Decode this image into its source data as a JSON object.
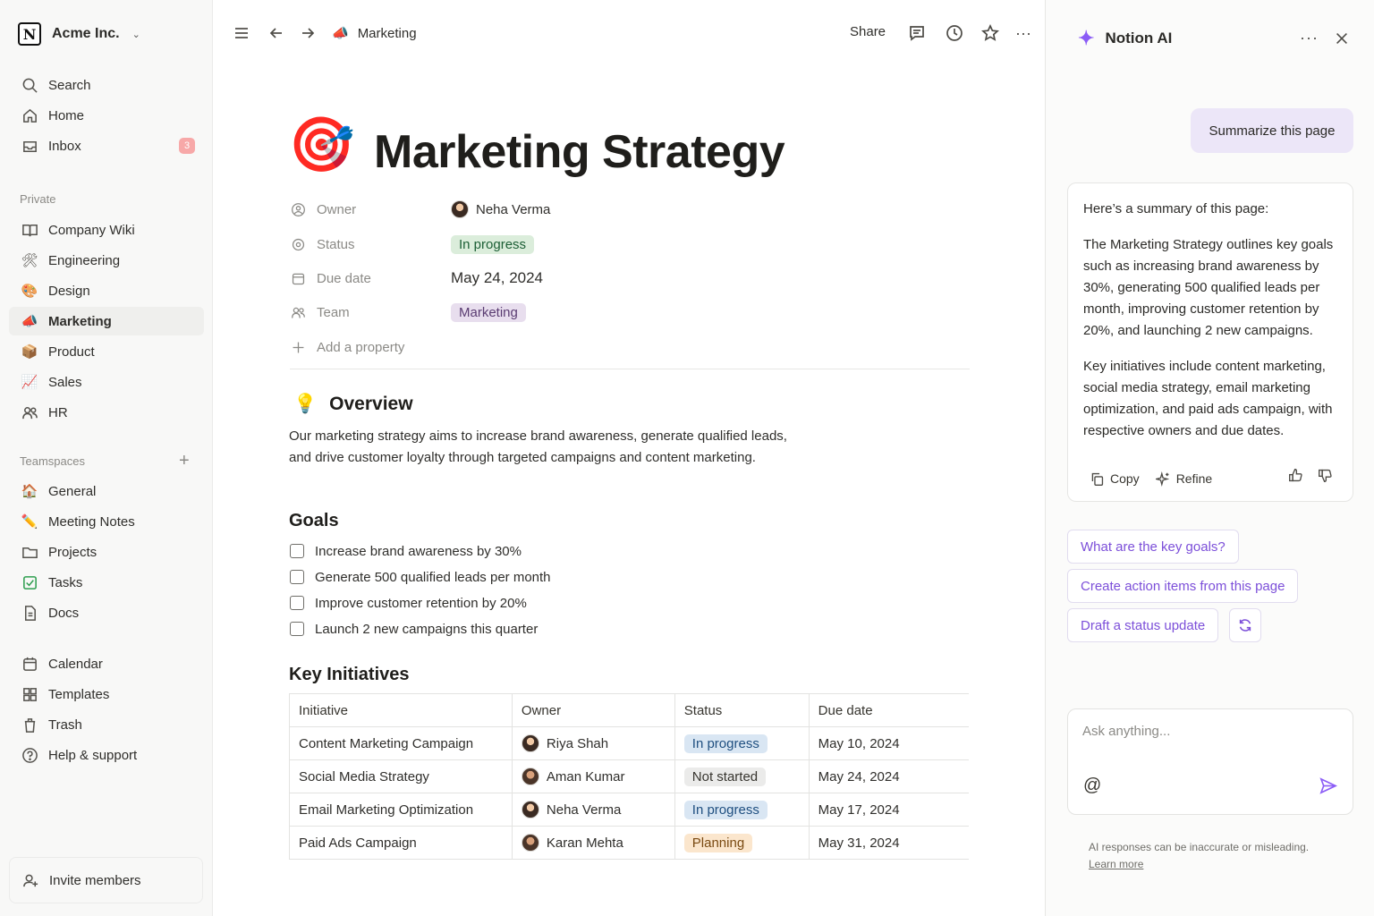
{
  "sidebar": {
    "workspace": "Acme Inc.",
    "nav": [
      {
        "label": "Search",
        "icon": "search-icon"
      },
      {
        "label": "Home",
        "icon": "home-icon"
      },
      {
        "label": "Inbox",
        "icon": "inbox-icon",
        "badge": "3"
      }
    ],
    "private_label": "Private",
    "private": [
      {
        "label": "Company Wiki",
        "icon": "book-icon"
      },
      {
        "label": "Engineering",
        "icon": "tools-icon"
      },
      {
        "label": "Design",
        "icon": "palette-icon"
      },
      {
        "label": "Marketing",
        "icon": "megaphone-icon",
        "active": true
      },
      {
        "label": "Product",
        "icon": "box-icon"
      },
      {
        "label": "Sales",
        "icon": "chart-icon"
      },
      {
        "label": "HR",
        "icon": "people-icon"
      }
    ],
    "teamspaces_label": "Teamspaces",
    "teamspaces": [
      {
        "label": "General",
        "icon": "house-icon"
      },
      {
        "label": "Meeting Notes",
        "icon": "pencil-icon"
      },
      {
        "label": "Projects",
        "icon": "folder-icon"
      },
      {
        "label": "Tasks",
        "icon": "checkbox-icon"
      },
      {
        "label": "Docs",
        "icon": "document-icon"
      }
    ],
    "tools": [
      {
        "label": "Calendar",
        "icon": "calendar-icon"
      },
      {
        "label": "Templates",
        "icon": "templates-icon"
      },
      {
        "label": "Trash",
        "icon": "trash-icon"
      },
      {
        "label": "Help & support",
        "icon": "help-icon"
      }
    ],
    "invite": "Invite members"
  },
  "topbar": {
    "breadcrumb": "Marketing",
    "share": "Share"
  },
  "page": {
    "icon": "🎯",
    "title": "Marketing Strategy",
    "properties": {
      "owner_label": "Owner",
      "owner": "Neha Verma",
      "status_label": "Status",
      "status": "In progress",
      "due_label": "Due date",
      "due": "May 24, 2024",
      "team_label": "Team",
      "team": "Marketing",
      "add_label": "Add a property"
    },
    "overview_icon": "💡",
    "overview_heading": "Overview",
    "overview_text": "Our marketing strategy aims to increase brand awareness, generate qualified leads, and drive customer loyalty through targeted campaigns and content marketing.",
    "goals_heading": "Goals",
    "goals": [
      "Increase brand awareness by 30%",
      "Generate 500 qualified leads per month",
      "Improve customer retention by 20%",
      "Launch 2 new campaigns this quarter"
    ],
    "initiatives_heading": "Key Initiatives",
    "table": {
      "headers": [
        "Initiative",
        "Owner",
        "Status",
        "Due date"
      ],
      "rows": [
        {
          "initiative": "Content Marketing Campaign",
          "owner": "Riya Shah",
          "status": "In progress",
          "due": "May 10, 2024"
        },
        {
          "initiative": "Social Media Strategy",
          "owner": "Aman Kumar",
          "status": "Not started",
          "due": "May 24, 2024"
        },
        {
          "initiative": "Email Marketing Optimization",
          "owner": "Neha Verma",
          "status": "In progress",
          "due": "May 17, 2024"
        },
        {
          "initiative": "Paid Ads Campaign",
          "owner": "Karan Mehta",
          "status": "Planning",
          "due": "May 31, 2024"
        }
      ]
    }
  },
  "ai": {
    "title": "Notion AI",
    "user_message": "Summarize this page",
    "answer_intro": "Here’s a summary of this page:",
    "answer_p1": "The Marketing Strategy outlines key goals such as increasing brand awareness by 30%, generating 500 qualified leads per month, improving customer retention by 20%, and launching 2 new campaigns.",
    "answer_p2": "Key initiatives include content marketing, social media strategy, email marketing optimization, and paid ads campaign, with respective owners and due dates.",
    "copy": "Copy",
    "refine": "Refine",
    "suggestions": [
      "What are the key goals?",
      "Create action items from this page",
      "Draft a status update"
    ],
    "input_placeholder": "Ask anything...",
    "at_symbol": "@",
    "disclaimer": "AI responses can be inaccurate or misleading.",
    "learn_more": "Learn more",
    "accent": "#8b5cf6"
  }
}
